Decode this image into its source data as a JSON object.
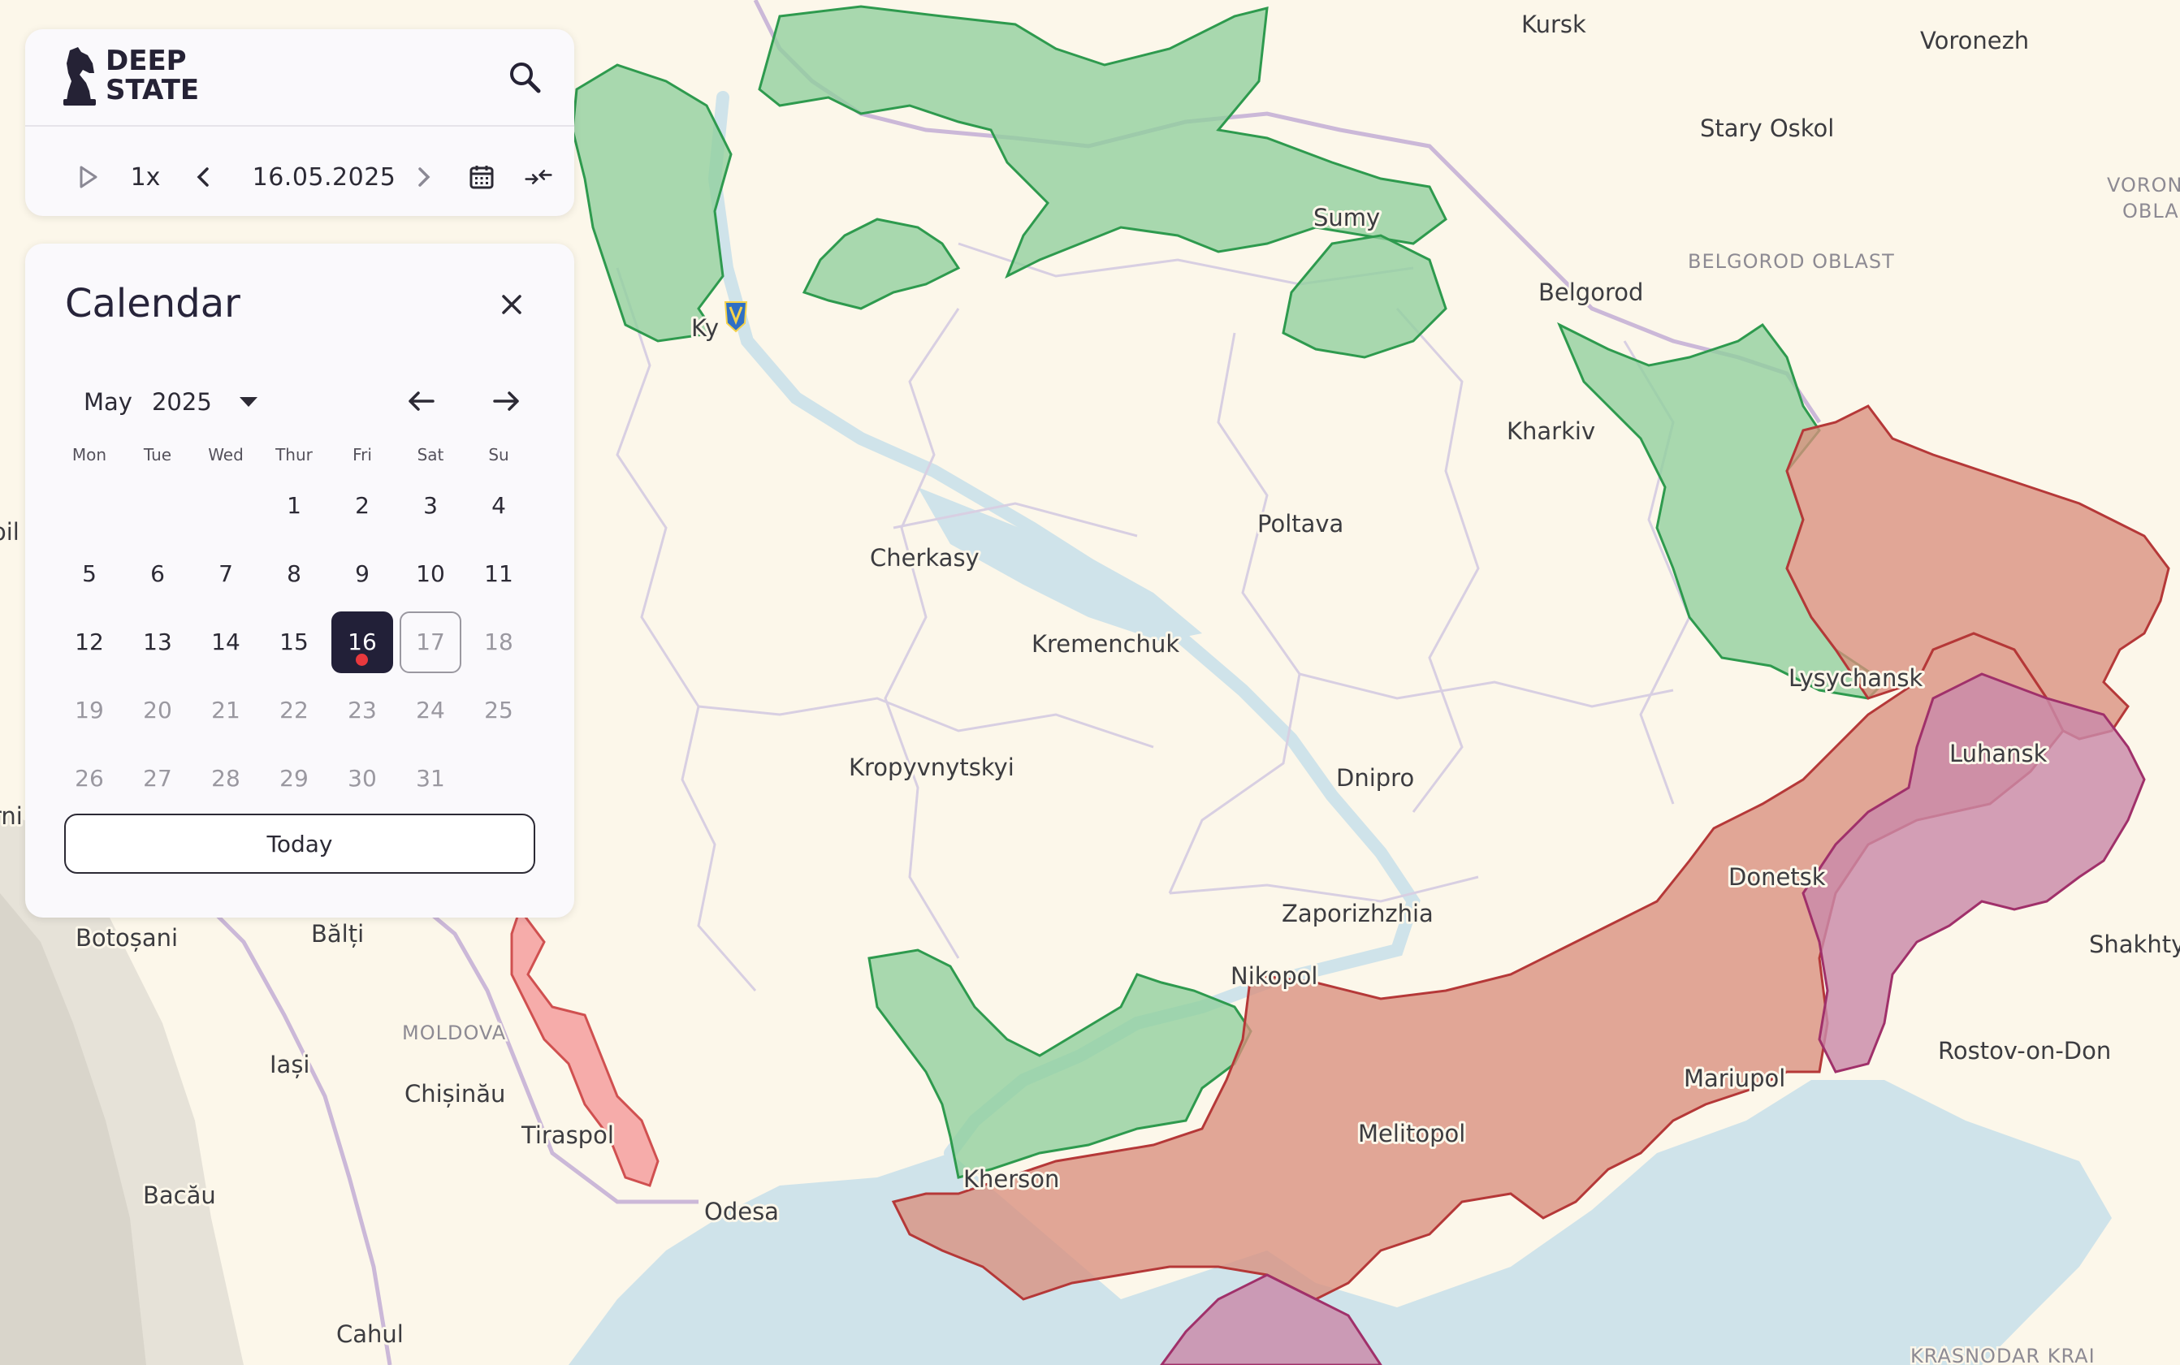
{
  "app": {
    "logo_line1": "DEEP",
    "logo_line2": "STATE",
    "speed": "1x",
    "date": "16.05.2025"
  },
  "icons": [
    "knight-logo-icon",
    "search-icon",
    "play-icon",
    "chevron-left-icon",
    "chevron-right-icon",
    "calendar-icon",
    "compare-arrows-icon",
    "close-icon",
    "caret-down-icon",
    "arrow-left-icon",
    "arrow-right-icon"
  ],
  "calendar": {
    "title": "Calendar",
    "month": "May",
    "year": "2025",
    "weekdays": [
      "Mon",
      "Tue",
      "Wed",
      "Thur",
      "Fri",
      "Sat",
      "Su"
    ],
    "weeks": [
      [
        "",
        "",
        "",
        "1",
        "2",
        "3",
        "4"
      ],
      [
        "5",
        "6",
        "7",
        "8",
        "9",
        "10",
        "11"
      ],
      [
        "12",
        "13",
        "14",
        "15",
        "16",
        "17",
        "18"
      ],
      [
        "19",
        "20",
        "21",
        "22",
        "23",
        "24",
        "25"
      ],
      [
        "26",
        "27",
        "28",
        "29",
        "30",
        "31",
        ""
      ]
    ],
    "selected_day": "16",
    "today_day": "17",
    "today_label": "Today"
  },
  "map": {
    "cities": [
      "Kursk",
      "Voronezh",
      "Stary Oskol",
      "VORON",
      "OBLAS",
      "BELGOROD OBLAST",
      "Belgorod",
      "Sumy",
      "Ky",
      "Kharkiv",
      "Poltava",
      "Cherkasy",
      "Kremenchuk",
      "Lysychansk",
      "Luhansk",
      "Kropyvnytskyi",
      "Dnipro",
      "Donetsk",
      "Zaporizhzhia",
      "Shakhty",
      "Nikopol",
      "Botoșani",
      "Bălți",
      "MOLDOVA",
      "Iași",
      "Chișinău",
      "Tiraspol",
      "Mariupol",
      "Rostov-on-Don",
      "Melitopol",
      "Bacău",
      "Odesa",
      "Kherson",
      "Cahul",
      "KRASNODAR KRAI",
      "oil",
      "rni"
    ],
    "colors": {
      "occupied": "#d9907e",
      "occupied_border": "#b53838",
      "liberated": "#8fcf9c",
      "liberated_border": "#2e9a4e",
      "pre2022": "#c98aaa",
      "transnistria": "#f5a3a3",
      "water": "#cfe3ea",
      "land": "#fcf7ea",
      "border": "#c9bfd6"
    }
  }
}
